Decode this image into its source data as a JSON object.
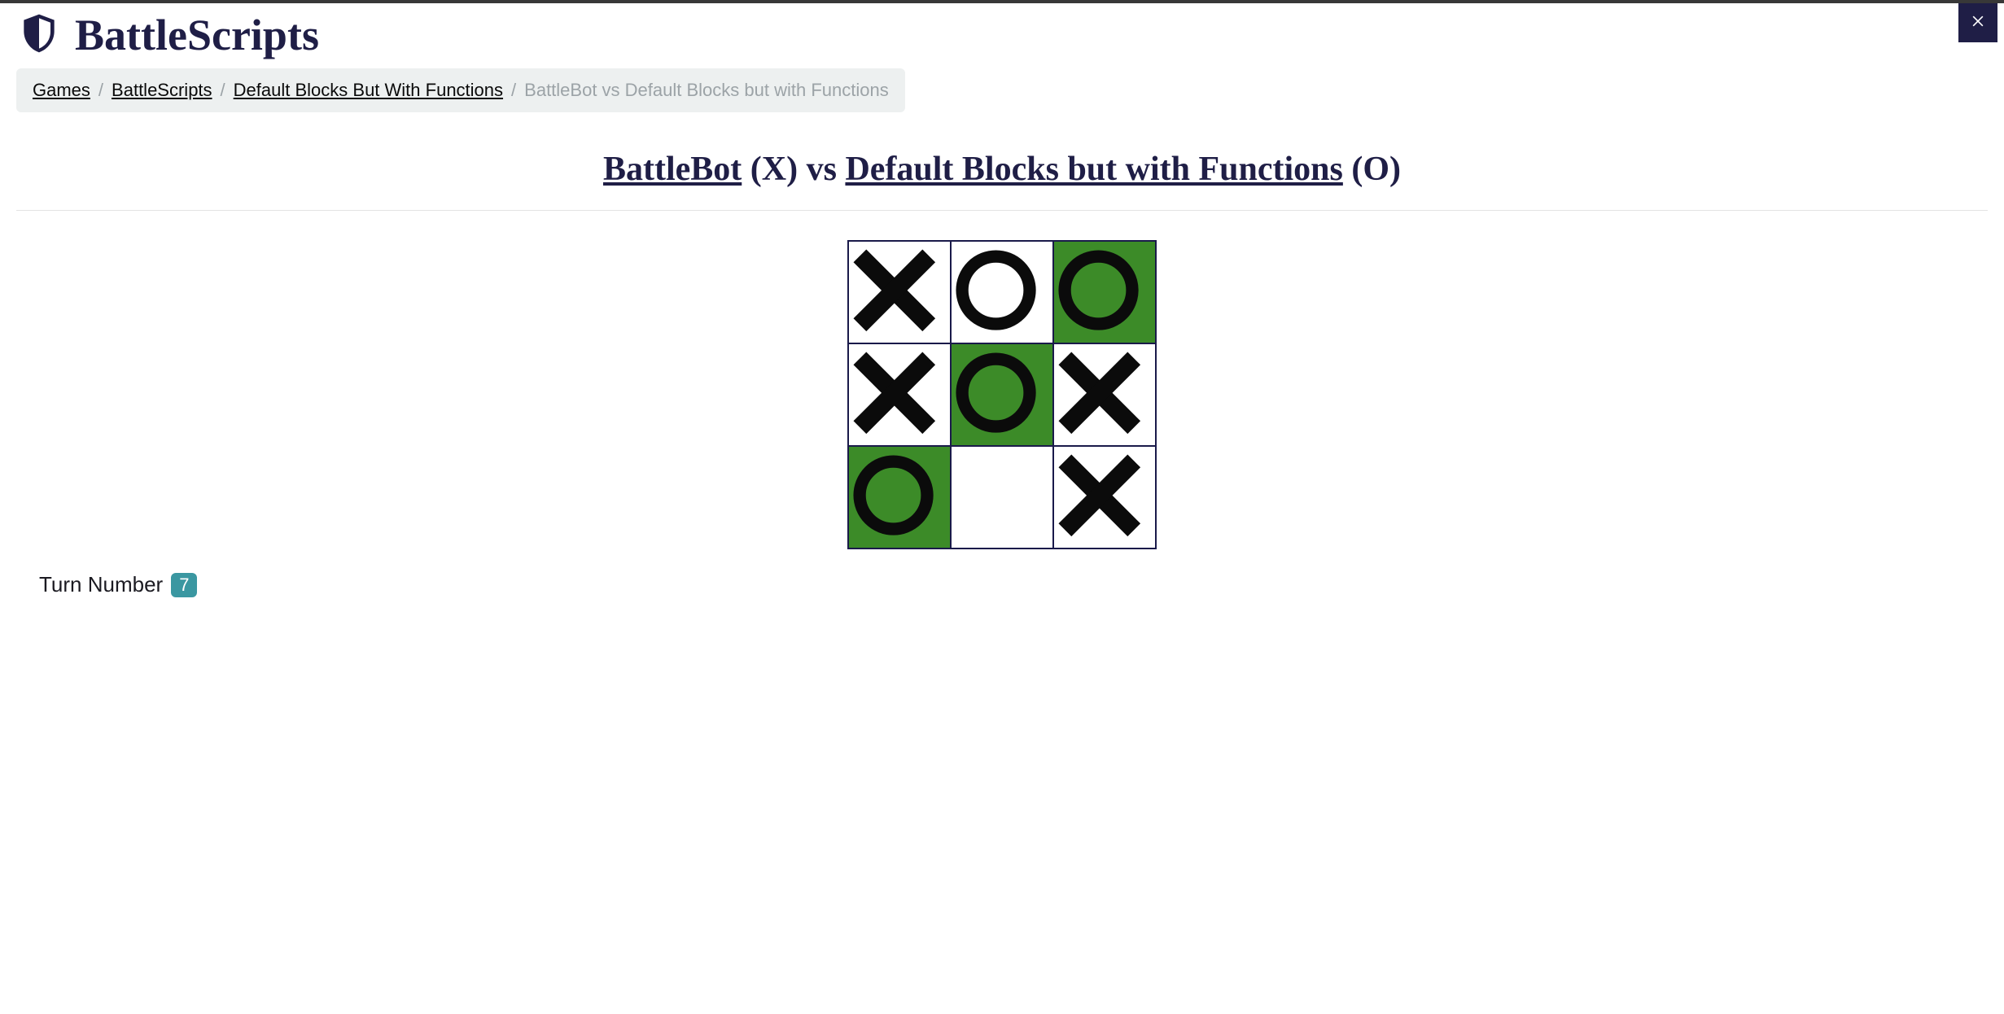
{
  "header": {
    "site_title": "BattleScripts"
  },
  "breadcrumb": {
    "items": [
      {
        "label": "Games"
      },
      {
        "label": "BattleScripts"
      },
      {
        "label": "Default Blocks But With Functions"
      }
    ],
    "current": "BattleBot vs Default Blocks but with Functions"
  },
  "match": {
    "player1_name": "BattleBot",
    "player1_mark": "(X)",
    "vs_label": "vs",
    "player2_name": "Default Blocks but with Functions",
    "player2_mark": "(O)"
  },
  "board": {
    "cells": [
      {
        "mark": "X",
        "win": false
      },
      {
        "mark": "O",
        "win": false
      },
      {
        "mark": "O",
        "win": true
      },
      {
        "mark": "X",
        "win": false
      },
      {
        "mark": "O",
        "win": true
      },
      {
        "mark": "X",
        "win": false
      },
      {
        "mark": "O",
        "win": true
      },
      {
        "mark": "",
        "win": false
      },
      {
        "mark": "X",
        "win": false
      }
    ]
  },
  "turn": {
    "label": "Turn Number",
    "value": "7"
  },
  "colors": {
    "win_bg": "#3c8b28",
    "brand": "#1f1e46",
    "badge": "#3a97a1"
  }
}
